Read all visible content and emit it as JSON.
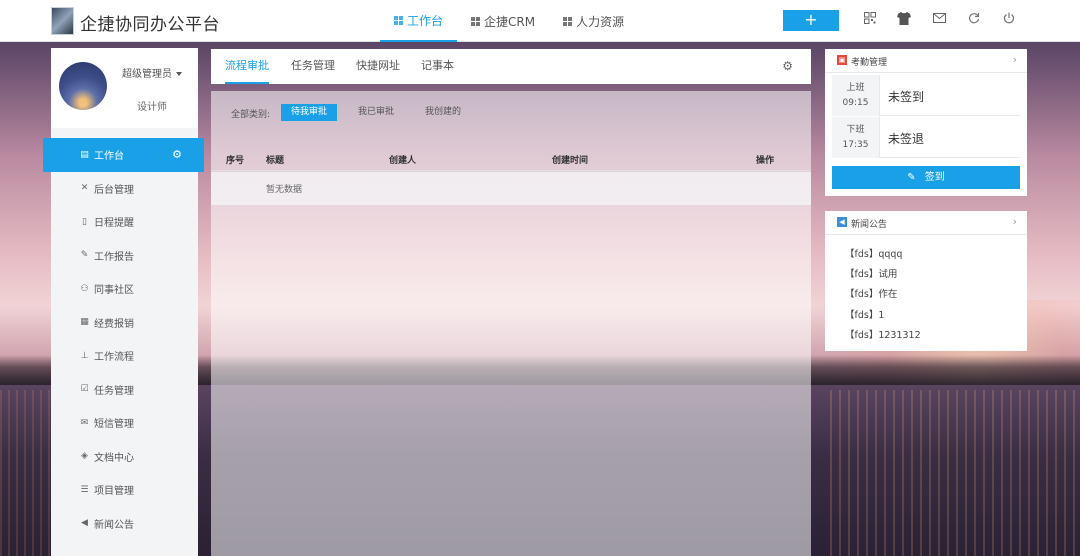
{
  "app": {
    "title": "企捷协同办公平台"
  },
  "nav": [
    {
      "label": "工作台",
      "active": true
    },
    {
      "label": "企捷CRM",
      "active": false
    },
    {
      "label": "人力资源",
      "active": false
    }
  ],
  "toolbar": {
    "plus_label": "+",
    "icons": [
      "qrcode-icon",
      "shirt-icon",
      "mail-icon",
      "refresh-icon",
      "power-icon"
    ]
  },
  "user": {
    "name": "超级管理员",
    "role": "设计师"
  },
  "sidebar": {
    "items": [
      {
        "label": "工作台",
        "icon": "briefcase-icon",
        "active": true
      },
      {
        "label": "后台管理",
        "icon": "tools-icon"
      },
      {
        "label": "日程提醒",
        "icon": "calendar-icon"
      },
      {
        "label": "工作报告",
        "icon": "report-icon"
      },
      {
        "label": "同事社区",
        "icon": "community-icon"
      },
      {
        "label": "经费报销",
        "icon": "expense-icon"
      },
      {
        "label": "工作流程",
        "icon": "flow-icon"
      },
      {
        "label": "任务管理",
        "icon": "task-icon"
      },
      {
        "label": "短信管理",
        "icon": "sms-icon"
      },
      {
        "label": "文档中心",
        "icon": "docs-icon"
      },
      {
        "label": "项目管理",
        "icon": "project-icon"
      },
      {
        "label": "新闻公告",
        "icon": "megaphone-icon"
      }
    ]
  },
  "tabs": [
    {
      "label": "流程审批",
      "active": true
    },
    {
      "label": "任务管理"
    },
    {
      "label": "快捷网址"
    },
    {
      "label": "记事本"
    }
  ],
  "filter": {
    "label": "全部类别:",
    "options": [
      {
        "label": "待我审批",
        "active": true
      },
      {
        "label": "我已审批"
      },
      {
        "label": "我创建的"
      }
    ]
  },
  "table": {
    "columns": [
      "序号",
      "标题",
      "创建人",
      "创建时间",
      "操作"
    ],
    "empty_text": "暂无数据"
  },
  "attendance": {
    "title": "考勤管理",
    "rows": [
      {
        "label": "上班",
        "time": "09:15",
        "status": "未签到"
      },
      {
        "label": "下班",
        "time": "17:35",
        "status": "未签退"
      }
    ],
    "sign_label": "签到"
  },
  "news": {
    "title": "新闻公告",
    "items": [
      "【fds】qqqq",
      "【fds】试用",
      "【fds】作在",
      "【fds】1",
      "【fds】1231312"
    ]
  },
  "colors": {
    "accent": "#1aa0e6",
    "attendance_icon": "#e8493a",
    "news_icon": "#3b8ed9"
  }
}
